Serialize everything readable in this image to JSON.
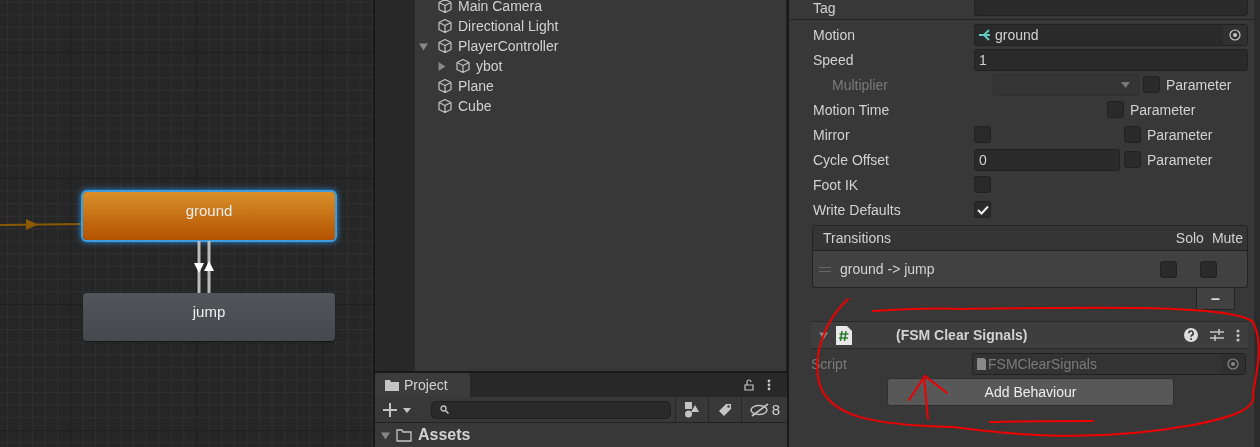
{
  "graph": {
    "states": [
      {
        "name": "ground",
        "kind": "default",
        "selected": true
      },
      {
        "name": "jump",
        "kind": "normal",
        "selected": false
      }
    ]
  },
  "hierarchy": {
    "items": [
      {
        "name": "Main Camera",
        "kind": "leaf"
      },
      {
        "name": "Directional Light",
        "kind": "leaf"
      },
      {
        "name": "PlayerController",
        "kind": "parent",
        "expanded": true,
        "children": [
          {
            "name": "ybot",
            "kind": "parent",
            "expanded": false
          }
        ]
      },
      {
        "name": "Plane",
        "kind": "leaf"
      },
      {
        "name": "Cube",
        "kind": "leaf"
      }
    ]
  },
  "project": {
    "tab": {
      "label": "Project",
      "selected": true
    },
    "hidden_count": "8",
    "tree": [
      {
        "name": "Assets",
        "expanded": true
      }
    ]
  },
  "inspector": {
    "tag_label": "Tag",
    "properties": [
      {
        "label": "Motion",
        "kind": "object",
        "value": "ground",
        "disabled": false
      },
      {
        "label": "Speed",
        "kind": "number",
        "value": "1",
        "disabled": false,
        "children": [
          {
            "label": "Multiplier",
            "kind": "dropdown",
            "disabled": true,
            "parameter": {
              "label": "Parameter",
              "checked": false
            }
          }
        ]
      },
      {
        "label": "Motion Time",
        "kind": "none",
        "disabled": false,
        "parameter": {
          "label": "Parameter",
          "checked": false
        }
      },
      {
        "label": "Mirror",
        "kind": "toggle",
        "checked": false,
        "disabled": false,
        "parameter": {
          "label": "Parameter",
          "checked": false
        }
      },
      {
        "label": "Cycle Offset",
        "kind": "number",
        "value": "0",
        "disabled": false,
        "parameter": {
          "label": "Parameter",
          "checked": false
        }
      },
      {
        "label": "Foot IK",
        "kind": "toggle",
        "checked": false,
        "disabled": false
      },
      {
        "label": "Write Defaults",
        "kind": "toggle",
        "checked": true,
        "disabled": false
      }
    ],
    "transitions": {
      "title": "Transitions",
      "solo_label": "Solo",
      "mute_label": "Mute",
      "rows": [
        {
          "label": "ground -> jump",
          "solo": false,
          "mute": false
        }
      ],
      "remove_label": "–"
    },
    "component": {
      "title": "(FSM Clear Signals)",
      "expanded": true,
      "script_label": "Script",
      "script_value": "FSMClearSignals"
    },
    "add_button": "Add Behaviour"
  }
}
